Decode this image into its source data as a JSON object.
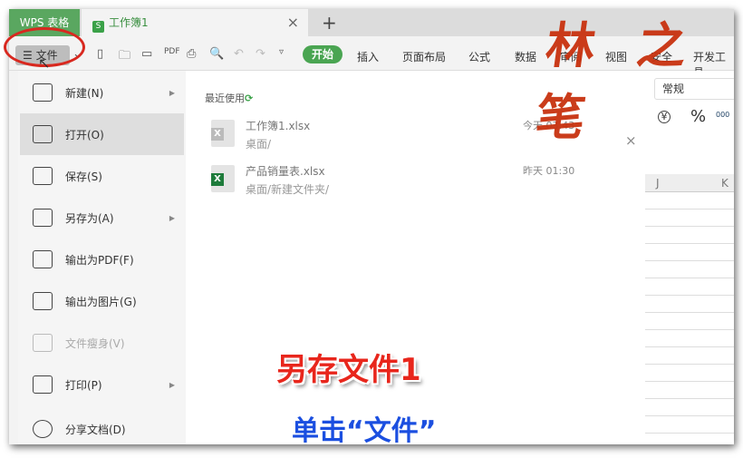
{
  "tabs": {
    "app": "WPS 表格",
    "doc": "工作簿1",
    "doc_icon": "S",
    "close": "×",
    "new": "+"
  },
  "toolbar": {
    "file": "文件",
    "start": "开始",
    "menus": [
      "插入",
      "页面布局",
      "公式",
      "数据",
      "审阅",
      "视图",
      "安全",
      "开发工具"
    ]
  },
  "file_menu": [
    {
      "label": "新建(N)",
      "arrow": true
    },
    {
      "label": "打开(O)",
      "selected": true
    },
    {
      "label": "保存(S)"
    },
    {
      "label": "另存为(A)",
      "arrow": true
    },
    {
      "label": "输出为PDF(F)"
    },
    {
      "label": "输出为图片(G)"
    },
    {
      "label": "文件瘦身(V)",
      "disabled": true
    },
    {
      "label": "打印(P)",
      "arrow": true
    },
    {
      "label": "分享文档(D)"
    }
  ],
  "recent": {
    "title": "最近使用",
    "files": [
      {
        "name": "工作簿1.xlsx",
        "path": "桌面/",
        "time": "今天 03:43"
      },
      {
        "name": "产品销量表.xlsx",
        "path": "桌面/新建文件夹/",
        "time": "昨天 01:30"
      }
    ]
  },
  "sheet": {
    "format": "常规",
    "currency": "¥",
    "percent": "%",
    "thousands": "000",
    "cols": [
      "J",
      "K"
    ]
  },
  "overlay": {
    "title": "另存文件1",
    "subtitle": "单击“文件”",
    "signature": "林之笔"
  },
  "colors": {
    "accent": "#4aa552",
    "overlay_red": "#e8261c",
    "overlay_blue": "#1b4fe0"
  }
}
